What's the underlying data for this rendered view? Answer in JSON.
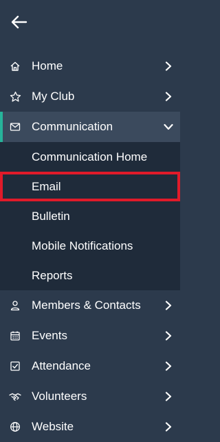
{
  "header": {
    "back_icon": "arrow-left-icon"
  },
  "nav": {
    "items": [
      {
        "label": "Home",
        "icon": "home-icon"
      },
      {
        "label": "My Club",
        "icon": "star-icon"
      },
      {
        "label": "Communication",
        "icon": "envelope-icon",
        "expanded": true
      },
      {
        "label": "Members & Contacts",
        "icon": "person-icon"
      },
      {
        "label": "Events",
        "icon": "calendar-icon"
      },
      {
        "label": "Attendance",
        "icon": "checkbox-icon"
      },
      {
        "label": "Volunteers",
        "icon": "handshake-icon"
      },
      {
        "label": "Website",
        "icon": "globe-icon"
      }
    ],
    "communication_sub": [
      {
        "label": "Communication Home"
      },
      {
        "label": "Email"
      },
      {
        "label": "Bulletin"
      },
      {
        "label": "Mobile Notifications"
      },
      {
        "label": "Reports"
      }
    ]
  },
  "colors": {
    "background": "#2c3a4c",
    "submenu_background": "#1f2b3a",
    "active_accent": "#27b39a",
    "highlight_outline": "#e01b2a"
  }
}
